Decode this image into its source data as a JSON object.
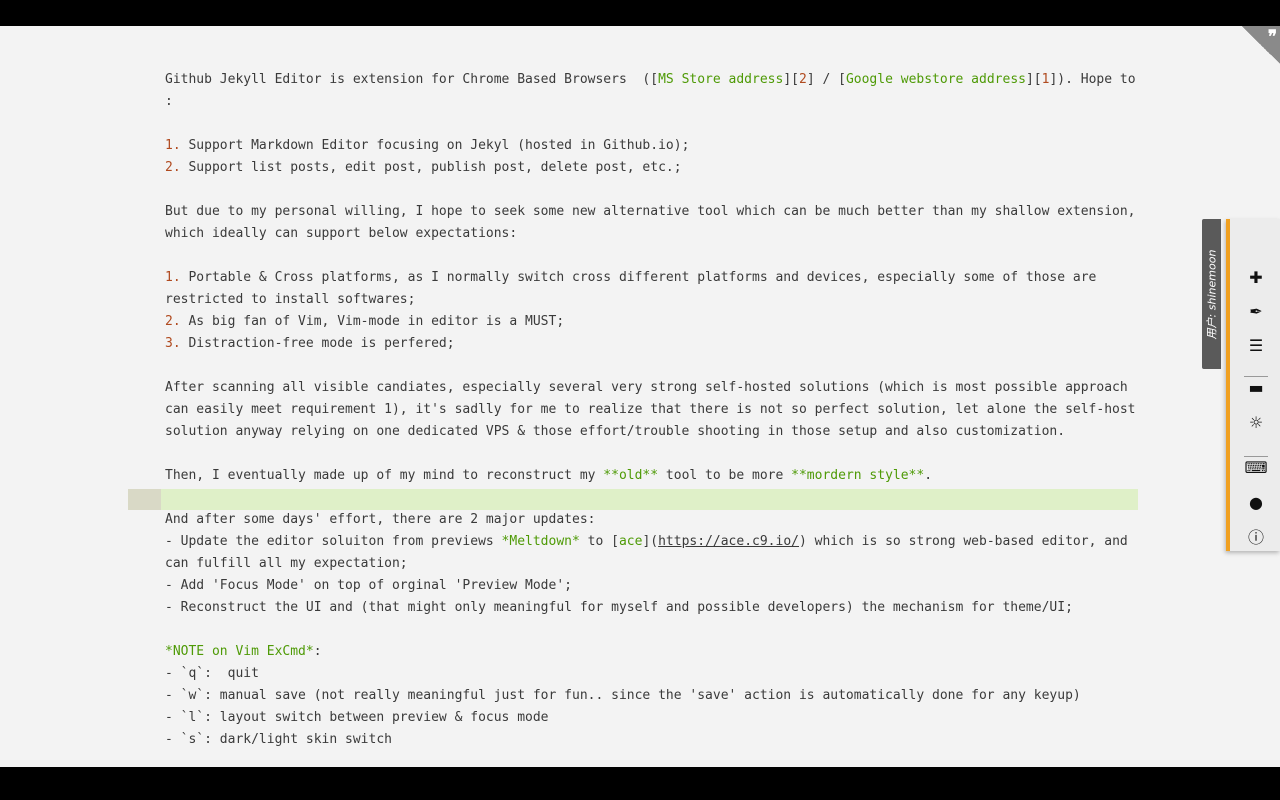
{
  "editor": {
    "lines": [
      [
        {
          "t": "Github Jekyll Editor is extension for Chrome Based Browsers  (["
        },
        {
          "t": "MS Store address",
          "c": "link"
        },
        {
          "t": "]["
        },
        {
          "t": "2",
          "c": "num"
        },
        {
          "t": "] / ["
        },
        {
          "t": "Google webstore address",
          "c": "link"
        },
        {
          "t": "]["
        },
        {
          "t": "1",
          "c": "num"
        },
        {
          "t": "]). Hope to"
        }
      ],
      [
        {
          "t": ":"
        }
      ],
      [],
      [
        {
          "t": "1.",
          "c": "num"
        },
        {
          "t": " Support Markdown Editor focusing on Jekyl (hosted in Github.io);"
        }
      ],
      [
        {
          "t": "2.",
          "c": "num"
        },
        {
          "t": " Support list posts, edit post, publish post, delete post, etc.;"
        }
      ],
      [],
      [
        {
          "t": "But due to my personal willing, I hope to seek some new alternative tool which can be much better than my shallow extension,"
        }
      ],
      [
        {
          "t": "which ideally can support below expectations:"
        }
      ],
      [],
      [
        {
          "t": "1.",
          "c": "num"
        },
        {
          "t": " Portable & Cross platforms, as I normally switch cross different platforms and devices, especially some of those are"
        }
      ],
      [
        {
          "t": "restricted to install softwares;"
        }
      ],
      [
        {
          "t": "2.",
          "c": "num"
        },
        {
          "t": " As big fan of Vim, Vim-mode in editor is a MUST;"
        }
      ],
      [
        {
          "t": "3.",
          "c": "num"
        },
        {
          "t": " Distraction-free mode is perfered;"
        }
      ],
      [],
      [
        {
          "t": "After scanning all visible candiates, especially several very strong self-hosted solutions (which is most possible approach"
        }
      ],
      [
        {
          "t": "can easily meet requirement 1), it's sadlly for me to realize that there is not so perfect solution, let alone the self-host"
        }
      ],
      [
        {
          "t": "solution anyway relying on one dedicated VPS & those effort/trouble shooting in those setup and also customization."
        }
      ],
      [],
      [
        {
          "t": "Then, I eventually made up of my mind to reconstruct my "
        },
        {
          "t": "**old**",
          "c": "mk"
        },
        {
          "t": " tool to be more "
        },
        {
          "t": "**mordern style**",
          "c": "mk"
        },
        {
          "t": "."
        }
      ],
      [],
      [
        {
          "t": "And after some days' effort, there are 2 major updates:"
        }
      ],
      [
        {
          "t": "- Update the editor soluiton from previews "
        },
        {
          "t": "*Meltdown*",
          "c": "mk"
        },
        {
          "t": " to ["
        },
        {
          "t": "ace",
          "c": "link"
        },
        {
          "t": "]("
        },
        {
          "t": "https://ace.c9.io/",
          "c": "url"
        },
        {
          "t": ") which is so strong web-based editor, and"
        }
      ],
      [
        {
          "t": "can fulfill all my expectation;"
        }
      ],
      [
        {
          "t": "- Add 'Focus Mode' on top of orginal 'Preview Mode';"
        }
      ],
      [
        {
          "t": "- Reconstruct the UI and (that might only meaningful for myself and possible developers) the mechanism for theme/UI;"
        }
      ],
      [],
      [
        {
          "t": "*NOTE on Vim ExCmd*",
          "c": "mk"
        },
        {
          "t": ":"
        }
      ],
      [
        {
          "t": "- `q`:  quit"
        }
      ],
      [
        {
          "t": "- `w`: manual save (not really meaningful just for fun.. since the 'save' action is automatically done for any keyup)"
        }
      ],
      [
        {
          "t": "- `l`: layout switch between preview & focus mode"
        }
      ],
      [
        {
          "t": "- `s`: dark/light skin switch"
        }
      ]
    ]
  },
  "side_tab": {
    "label": "用户: shinemoon"
  },
  "corner_tab": {
    "icon": "quote-icon",
    "glyph": "❞"
  },
  "toolbar": [
    {
      "name": "add-icon",
      "glyph": "✚"
    },
    {
      "name": "pen-icon",
      "glyph": "✒"
    },
    {
      "name": "list-icon",
      "glyph": "☰"
    },
    {
      "sep": true
    },
    {
      "name": "paint-roller-icon",
      "glyph": "▬"
    },
    {
      "name": "sun-icon",
      "glyph": "☼"
    },
    {
      "sep": true
    },
    {
      "name": "keyboard-icon",
      "glyph": "⌨"
    },
    {
      "name": "github-icon",
      "glyph": "●"
    },
    {
      "name": "info-icon",
      "glyph": "ⓘ"
    }
  ],
  "colors": {
    "accent": "#f0a020",
    "markdown": "#4e9a06",
    "number": "#b04a1f",
    "active_line": "#dff0c8"
  }
}
